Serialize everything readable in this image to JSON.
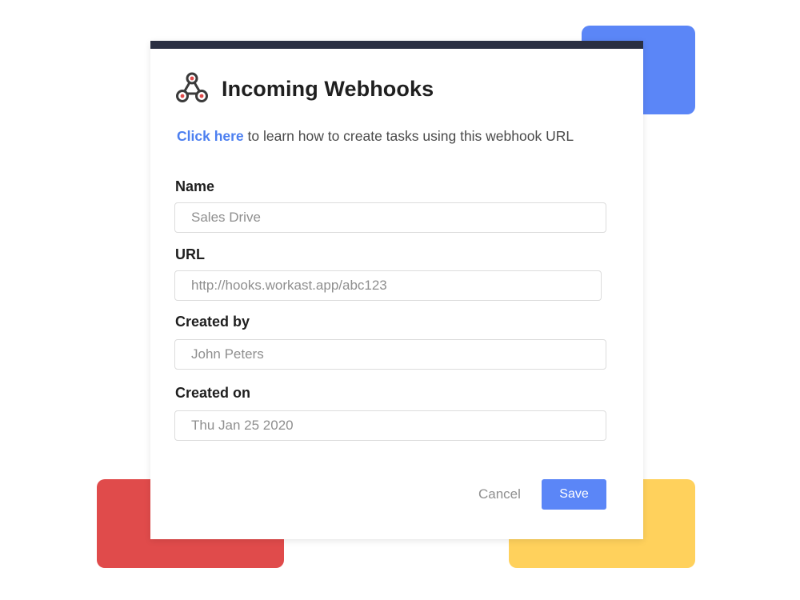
{
  "colors": {
    "accent_blue": "#5b86f7",
    "deco_blue": "#5b86f7",
    "deco_red": "#e04b4b",
    "deco_yellow": "#ffd15c",
    "card_top_border": "#2a2f42",
    "link": "#4c7ff0",
    "save_button": "#5b86f7"
  },
  "dialog": {
    "icon": "webhook-icon",
    "title": "Incoming Webhooks",
    "help_link": "Click here",
    "help_text": " to learn how to create tasks using this webhook URL"
  },
  "form": {
    "name_label": "Name",
    "name_value": "Sales Drive",
    "url_label": "URL",
    "url_value": "http://hooks.workast.app/abc123",
    "created_by_label": "Created by",
    "created_by_value": "John Peters",
    "created_on_label": "Created on",
    "created_on_value": "Thu Jan 25 2020"
  },
  "actions": {
    "cancel_label": "Cancel",
    "save_label": "Save"
  }
}
